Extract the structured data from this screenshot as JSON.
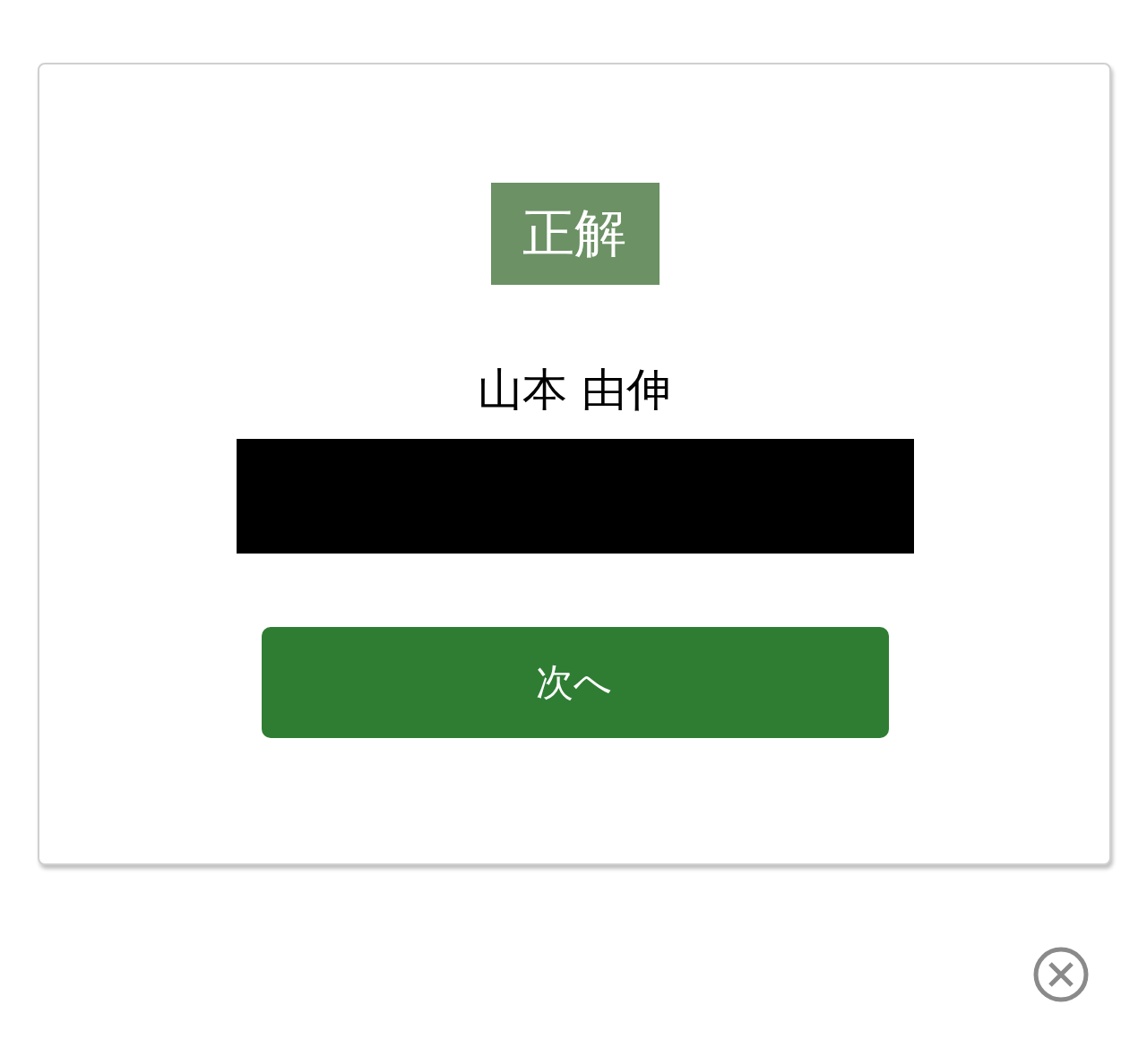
{
  "result": {
    "badge": "正解",
    "answer": "山本 由伸"
  },
  "buttons": [
    {
      "label": "次へ"
    }
  ]
}
